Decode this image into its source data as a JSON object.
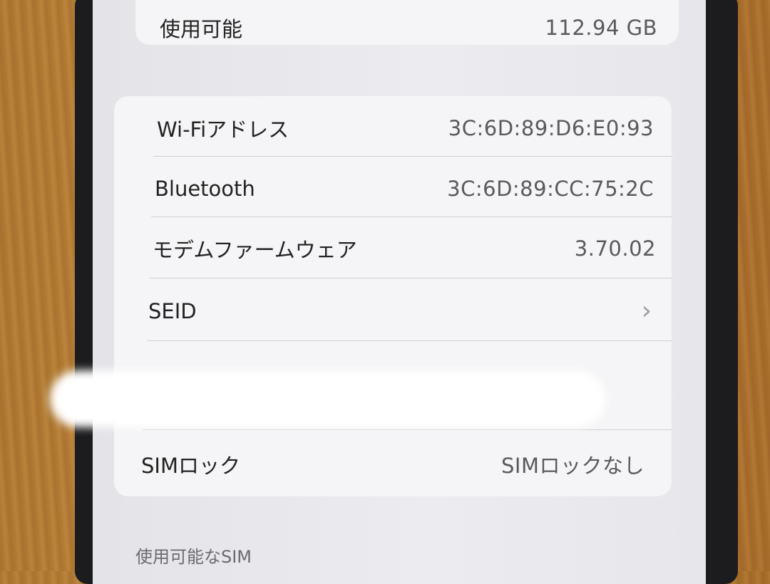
{
  "top_group": {
    "available_label": "使用可能",
    "available_value": "112.94 GB"
  },
  "info_group": {
    "wifi_label": "Wi-Fiアドレス",
    "wifi_value": "3C:6D:89:D6:E0:93",
    "bluetooth_label": "Bluetooth",
    "bluetooth_value": "3C:6D:89:CC:75:2C",
    "modem_label": "モデムファームウェア",
    "modem_value": "3.70.02",
    "seid_label": "SEID",
    "simlock_label": "SIMロック",
    "simlock_value": "SIMロックなし"
  },
  "footer": {
    "available_sim_header": "使用可能なSIM"
  }
}
